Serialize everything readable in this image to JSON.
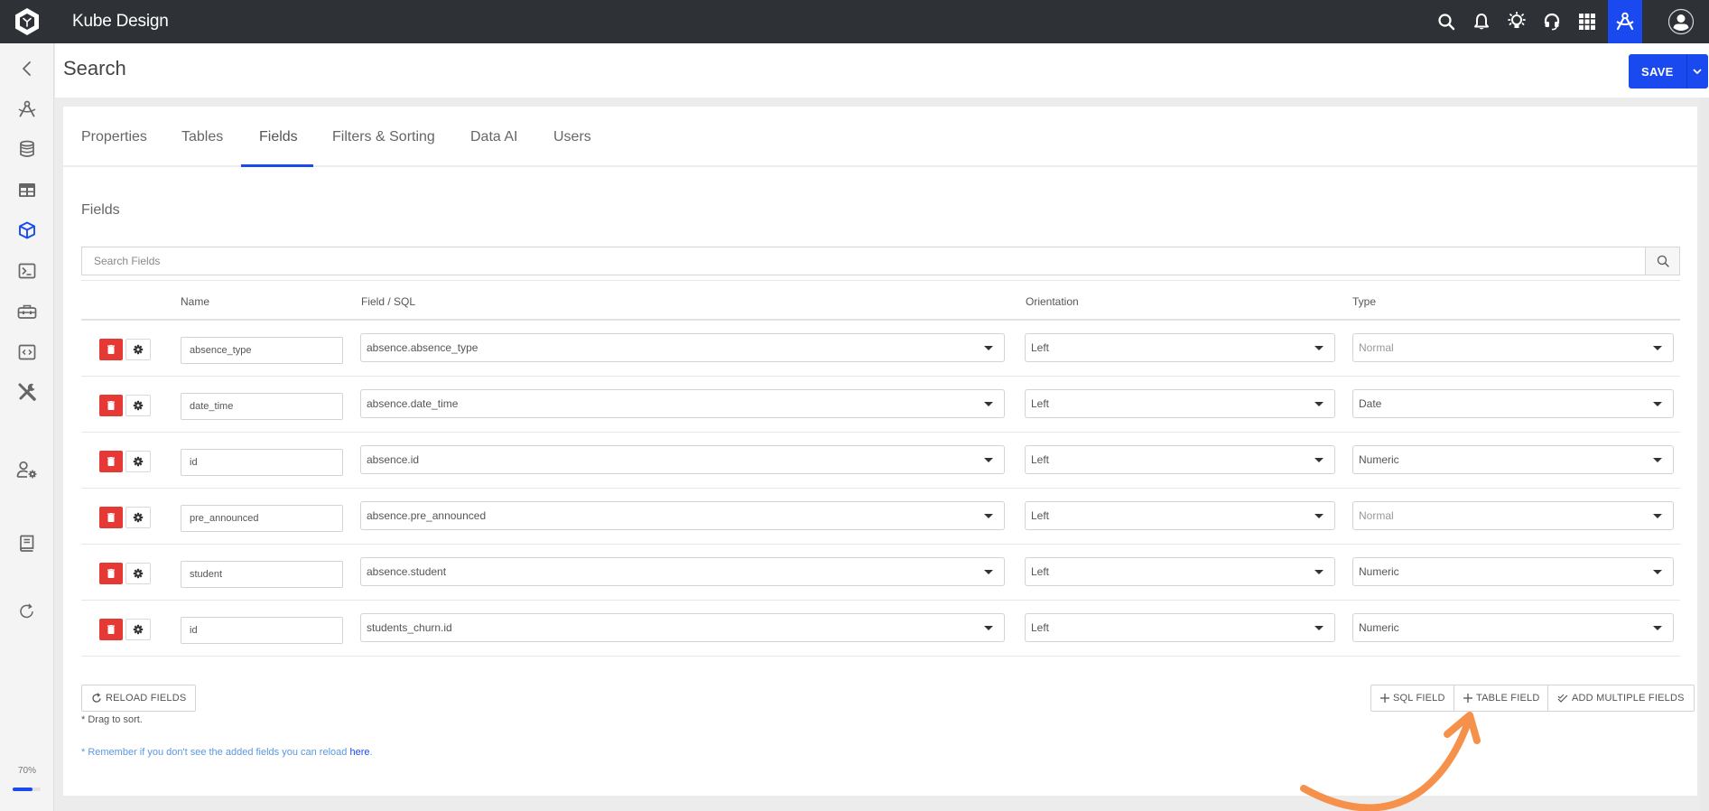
{
  "app": {
    "title": "Kube Design",
    "logo_icon": "kube-hexagon-logo"
  },
  "topbar": {
    "icons": [
      {
        "name": "search-icon",
        "label": "Search"
      },
      {
        "name": "bell-icon",
        "label": "Notifications"
      },
      {
        "name": "lightbulb-icon",
        "label": "Ideas"
      },
      {
        "name": "headset-icon",
        "label": "Support"
      },
      {
        "name": "apps-grid-icon",
        "label": "Apps"
      },
      {
        "name": "compass-design-icon",
        "label": "Design",
        "active": true
      },
      {
        "name": "user-avatar-icon",
        "label": "Account"
      }
    ]
  },
  "sidebar": {
    "items": [
      {
        "name": "back-icon",
        "label": "Back"
      },
      {
        "name": "compass-icon",
        "label": "Design"
      },
      {
        "name": "database-icon",
        "label": "Databases"
      },
      {
        "name": "table-icon",
        "label": "Tables"
      },
      {
        "name": "cube-icon",
        "label": "Models",
        "active": true
      },
      {
        "name": "terminal-icon",
        "label": "Console"
      },
      {
        "name": "toolbox-icon",
        "label": "Tools"
      },
      {
        "name": "code-icon",
        "label": "Code"
      },
      {
        "name": "wrench-screwdriver-icon",
        "label": "Settings"
      },
      {
        "name": "user-settings-icon",
        "label": "User Settings"
      },
      {
        "name": "book-icon",
        "label": "Documentation"
      },
      {
        "name": "refresh-icon",
        "label": "Refresh"
      }
    ],
    "zoom": {
      "label": "70%",
      "value_percent": 70
    }
  },
  "page": {
    "title": "Search",
    "save_label": "SAVE"
  },
  "tabs": [
    {
      "label": "Properties"
    },
    {
      "label": "Tables"
    },
    {
      "label": "Fields",
      "active": true
    },
    {
      "label": "Filters & Sorting"
    },
    {
      "label": "Data AI"
    },
    {
      "label": "Users"
    }
  ],
  "fields": {
    "section_title": "Fields",
    "search_placeholder": "Search Fields",
    "columns": {
      "name": "Name",
      "field_sql": "Field / SQL",
      "orientation": "Orientation",
      "type": "Type"
    },
    "rows": [
      {
        "name": "absence_type",
        "field": "absence.absence_type",
        "orientation": "Left",
        "type": "Normal",
        "type_is_placeholder": true
      },
      {
        "name": "date_time",
        "field": "absence.date_time",
        "orientation": "Left",
        "type": "Date",
        "type_is_placeholder": false
      },
      {
        "name": "id",
        "field": "absence.id",
        "orientation": "Left",
        "type": "Numeric",
        "type_is_placeholder": false
      },
      {
        "name": "pre_announced",
        "field": "absence.pre_announced",
        "orientation": "Left",
        "type": "Normal",
        "type_is_placeholder": true
      },
      {
        "name": "student",
        "field": "absence.student",
        "orientation": "Left",
        "type": "Numeric",
        "type_is_placeholder": false
      },
      {
        "name": "id",
        "field": "students_churn.id",
        "orientation": "Left",
        "type": "Numeric",
        "type_is_placeholder": false
      }
    ],
    "buttons": {
      "reload": "RELOAD FIELDS",
      "sql_field": "SQL FIELD",
      "table_field": "TABLE FIELD",
      "add_multiple": "ADD MULTIPLE FIELDS"
    },
    "drag_note": "* Drag to sort.",
    "remember_note": "* Remember if you don't see the added fields you can reload ",
    "remember_link": "here",
    "remember_end": "."
  },
  "annotation": {
    "arrow_color": "#f5914a",
    "points_to": "TABLE FIELD"
  },
  "colors": {
    "accent": "#1a49f0",
    "danger": "#e53935",
    "header_bg": "#2e3135"
  }
}
